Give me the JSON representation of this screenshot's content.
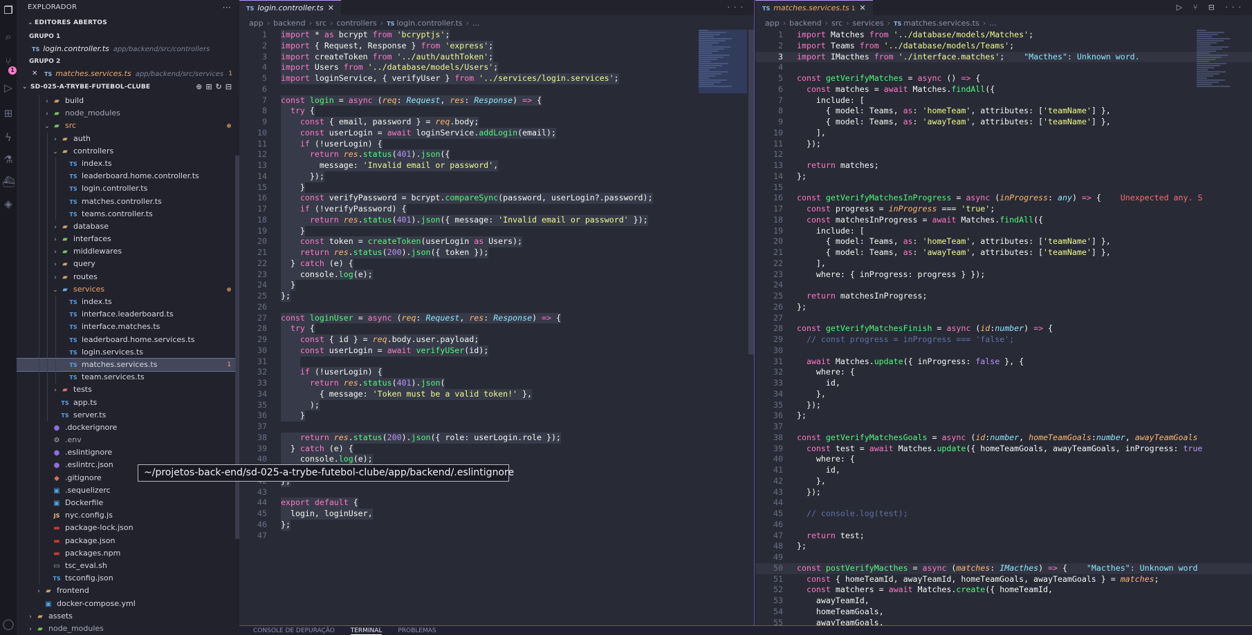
{
  "sidebar": {
    "title": "EXPLORADOR",
    "open_editors": "EDITORES ABERTOS",
    "group1": "GRUPO 1",
    "group1_file": "login.controller.ts",
    "group1_path": "app/backend/src/controllers",
    "group2": "GRUPO 2",
    "group2_file": "matches.services.ts",
    "group2_path": "app/backend/src/services",
    "group2_count": "1",
    "project": "SD-025-A-TRYBE-FUTEBOL-CLUBE",
    "tree": [
      {
        "name": "build",
        "indent": 1,
        "type": "folder",
        "chev": "›"
      },
      {
        "name": "node_modules",
        "indent": 1,
        "type": "folder-green",
        "chev": "›",
        "dim": true
      },
      {
        "name": "src",
        "indent": 1,
        "type": "folder-green",
        "chev": "⌄",
        "mod": true,
        "dot": true
      },
      {
        "name": "auth",
        "indent": 2,
        "type": "folder",
        "chev": "›"
      },
      {
        "name": "controllers",
        "indent": 2,
        "type": "folder",
        "chev": "⌄"
      },
      {
        "name": "index.ts",
        "indent": 3,
        "type": "ts"
      },
      {
        "name": "leaderboard.home.controller.ts",
        "indent": 3,
        "type": "ts"
      },
      {
        "name": "login.controller.ts",
        "indent": 3,
        "type": "ts"
      },
      {
        "name": "matches.controller.ts",
        "indent": 3,
        "type": "ts"
      },
      {
        "name": "teams.controller.ts",
        "indent": 3,
        "type": "ts"
      },
      {
        "name": "database",
        "indent": 2,
        "type": "folder",
        "chev": "›"
      },
      {
        "name": "interfaces",
        "indent": 2,
        "type": "folder-green",
        "chev": "›"
      },
      {
        "name": "middlewares",
        "indent": 2,
        "type": "folder-green",
        "chev": "›"
      },
      {
        "name": "query",
        "indent": 2,
        "type": "folder",
        "chev": "›"
      },
      {
        "name": "routes",
        "indent": 2,
        "type": "folder",
        "chev": "›"
      },
      {
        "name": "services",
        "indent": 2,
        "type": "folder-blue",
        "chev": "⌄",
        "mod": true,
        "dot": true
      },
      {
        "name": "index.ts",
        "indent": 3,
        "type": "ts"
      },
      {
        "name": "interface.leaderboard.ts",
        "indent": 3,
        "type": "ts"
      },
      {
        "name": "interface.matches.ts",
        "indent": 3,
        "type": "ts"
      },
      {
        "name": "leaderboard.home.services.ts",
        "indent": 3,
        "type": "ts"
      },
      {
        "name": "login.services.ts",
        "indent": 3,
        "type": "ts"
      },
      {
        "name": "matches.services.ts",
        "indent": 3,
        "type": "ts",
        "selected": true,
        "count": "1"
      },
      {
        "name": "team.services.ts",
        "indent": 3,
        "type": "ts"
      },
      {
        "name": "tests",
        "indent": 2,
        "type": "folder-red",
        "chev": "›"
      },
      {
        "name": "app.ts",
        "indent": 2,
        "type": "ts"
      },
      {
        "name": "server.ts",
        "indent": 2,
        "type": "ts"
      },
      {
        "name": ".dockerignore",
        "indent": 1,
        "type": "dot"
      },
      {
        "name": ".env",
        "indent": 1,
        "type": "gear",
        "dim": true
      },
      {
        "name": ".eslintignore",
        "indent": 1,
        "type": "dot"
      },
      {
        "name": ".eslintrc.json",
        "indent": 1,
        "type": "dot"
      },
      {
        "name": ".gitignore",
        "indent": 1,
        "type": "git"
      },
      {
        "name": ".sequelizerc",
        "indent": 1,
        "type": "whale"
      },
      {
        "name": "Dockerfile",
        "indent": 1,
        "type": "whale"
      },
      {
        "name": "nyc.config.js",
        "indent": 1,
        "type": "js"
      },
      {
        "name": "package-lock.json",
        "indent": 1,
        "type": "npm"
      },
      {
        "name": "package.json",
        "indent": 1,
        "type": "npm"
      },
      {
        "name": "packages.npm",
        "indent": 1,
        "type": "npm"
      },
      {
        "name": "tsc_eval.sh",
        "indent": 1,
        "type": "term"
      },
      {
        "name": "tsconfig.json",
        "indent": 1,
        "type": "ts"
      },
      {
        "name": "frontend",
        "indent": 0,
        "type": "folder",
        "chev": "›"
      },
      {
        "name": "docker-compose.yml",
        "indent": 0,
        "type": "whale"
      },
      {
        "name": "assets",
        "indent": -1,
        "type": "folder",
        "chev": "›"
      },
      {
        "name": "node_modules",
        "indent": -1,
        "type": "folder-green",
        "chev": "›",
        "dim": true
      }
    ],
    "tooltip": "~/projetos-back-end/sd-025-a-trybe-futebol-clube/app/backend/.eslintignore"
  },
  "editor1": {
    "tab": "login.controller.ts",
    "crumbs": [
      "app",
      "backend",
      "src",
      "controllers",
      "login.controller.ts",
      "..."
    ]
  },
  "editor2": {
    "tab": "matches.services.ts",
    "tab_count": "1",
    "crumbs": [
      "app",
      "backend",
      "src",
      "services",
      "matches.services.ts",
      "..."
    ]
  },
  "panel": {
    "tabs": [
      "CONSOLE DE DEPURAÇÃO",
      "TERMINAL",
      "PROBLEMAS"
    ]
  },
  "colors": {
    "accent": "#bd93f9",
    "keyword": "#ff79c6",
    "string": "#f1fa8c",
    "function": "#50fa7b",
    "param": "#ffb86c",
    "type": "#8be9fd",
    "modified": "#f0a76a"
  }
}
